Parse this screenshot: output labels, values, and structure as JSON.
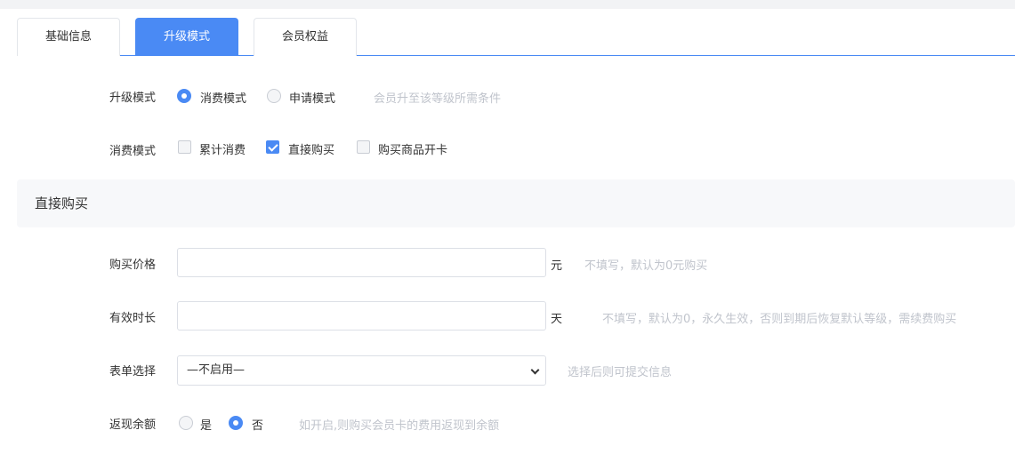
{
  "tabs": [
    {
      "label": "基础信息",
      "active": false
    },
    {
      "label": "升级模式",
      "active": true
    },
    {
      "label": "会员权益",
      "active": false
    }
  ],
  "upgrade_mode": {
    "label": "升级模式",
    "options": [
      {
        "label": "消费模式",
        "checked": true
      },
      {
        "label": "申请模式",
        "checked": false
      }
    ],
    "hint": "会员升至该等级所需条件"
  },
  "consume_mode": {
    "label": "消费模式",
    "options": [
      {
        "label": "累计消费",
        "checked": false
      },
      {
        "label": "直接购买",
        "checked": true
      },
      {
        "label": "购买商品开卡",
        "checked": false
      }
    ]
  },
  "direct_purchase": {
    "title": "直接购买",
    "price": {
      "label": "购买价格",
      "value": "",
      "unit": "元",
      "hint": "不填写，默认为0元购买"
    },
    "duration": {
      "label": "有效时长",
      "value": "",
      "unit": "天",
      "hint": "不填写，默认为0，永久生效，否则到期后恢复默认等级，需续费购买"
    },
    "form_select": {
      "label": "表单选择",
      "selected": "—不启用—",
      "hint": "选择后则可提交信息"
    },
    "cashback": {
      "label": "返现余额",
      "options": [
        {
          "label": "是",
          "checked": false
        },
        {
          "label": "否",
          "checked": true
        }
      ],
      "hint": "如开启,则购买会员卡的费用返现到余额"
    }
  },
  "colors": {
    "accent": "#4a8af4",
    "hint": "#c0c4cc"
  }
}
